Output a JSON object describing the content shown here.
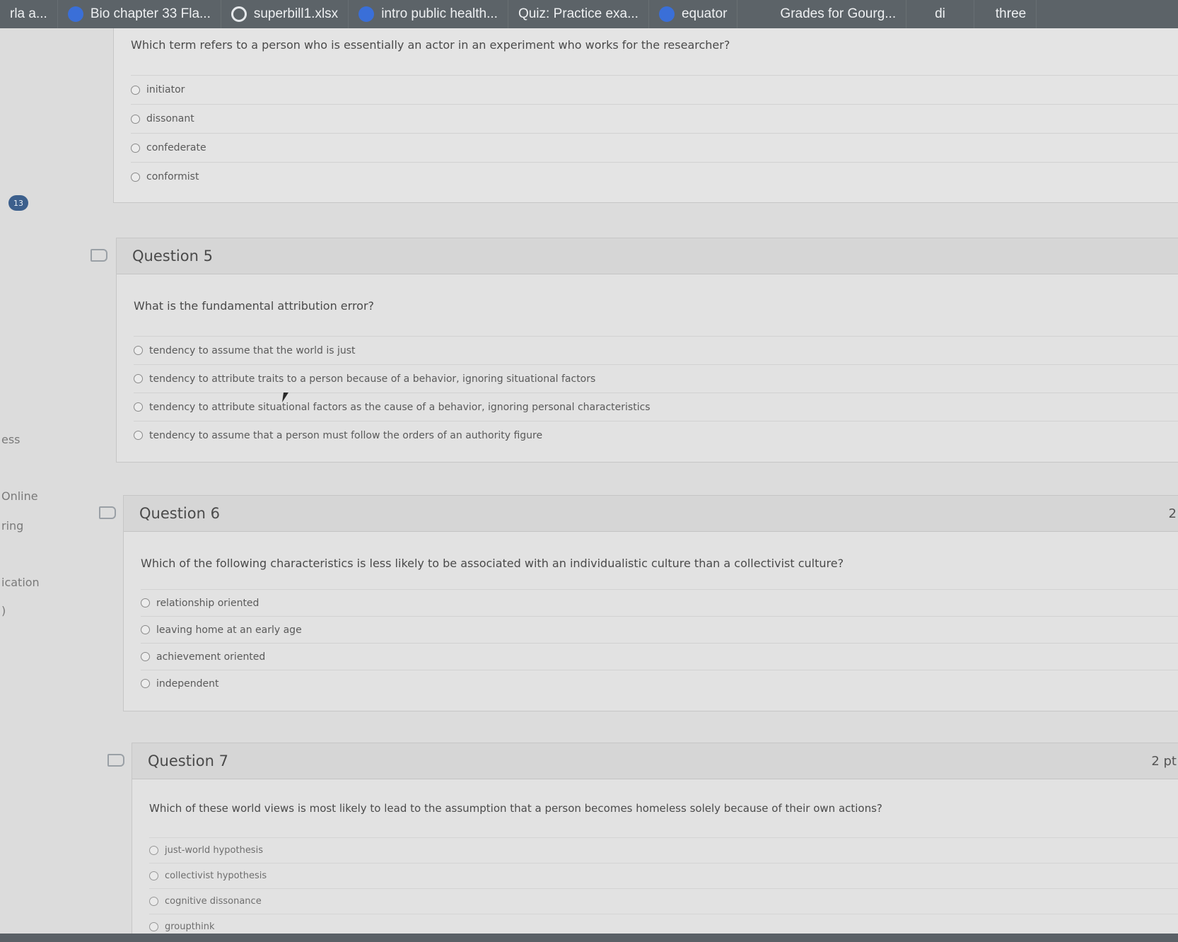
{
  "tabs": [
    {
      "label": "rla a...",
      "icon": "none"
    },
    {
      "label": "Bio chapter 33 Fla...",
      "icon": "blue"
    },
    {
      "label": "superbill1.xlsx",
      "icon": "ring"
    },
    {
      "label": "intro public health...",
      "icon": "blue"
    },
    {
      "label": "Quiz: Practice exa...",
      "icon": "none"
    },
    {
      "label": "equator",
      "icon": "blue"
    },
    {
      "label": "Grades for Gourg...",
      "icon": "none"
    },
    {
      "label": "di",
      "icon": "none"
    },
    {
      "label": "three",
      "icon": "none"
    }
  ],
  "sidebar": {
    "badge": "13",
    "items": [
      "ess",
      "Online",
      "ring",
      "ication",
      ")"
    ]
  },
  "q4": {
    "text": "Which term refers to a person who is essentially an actor in an experiment who works for the researcher?",
    "answers": [
      "initiator",
      "dissonant",
      "confederate",
      "conformist"
    ]
  },
  "q5": {
    "title": "Question 5",
    "text": "What is the fundamental attribution error?",
    "answers": [
      "tendency to assume that the world is just",
      "tendency to attribute traits to a person because of a behavior, ignoring situational factors",
      "tendency to attribute situational factors as the cause of a behavior, ignoring personal characteristics",
      "tendency to assume that a person must follow the orders of an authority figure"
    ]
  },
  "q6": {
    "title": "Question 6",
    "points": "2",
    "text": "Which of the following characteristics is less likely to be associated with an individualistic culture than a collectivist culture?",
    "answers": [
      "relationship oriented",
      "leaving home at an early age",
      "achievement oriented",
      "independent"
    ]
  },
  "q7": {
    "title": "Question 7",
    "points": "2 pt",
    "text": "Which of these world views is most likely to lead to the assumption that a person becomes homeless solely because of their own actions?",
    "answers": [
      "just-world hypothesis",
      "collectivist hypothesis",
      "cognitive dissonance",
      "groupthink"
    ]
  }
}
